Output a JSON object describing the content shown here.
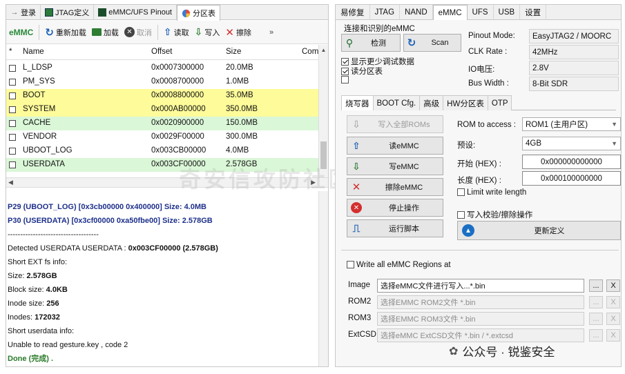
{
  "left": {
    "tabs": [
      {
        "icon": "login-icon",
        "label": "登录"
      },
      {
        "icon": "jtag-icon",
        "label": "JTAG定义"
      },
      {
        "icon": "emmc-chip-icon",
        "label": "eMMC/UFS Pinout"
      },
      {
        "icon": "pie-icon",
        "label": "分区表"
      }
    ],
    "toolbar": {
      "logo": "eMMC",
      "reload": "重新加载",
      "load": "加载",
      "cancel": "取消",
      "read": "读取",
      "write": "写入",
      "erase": "擦除",
      "overflow": "»"
    },
    "table": {
      "headers": [
        "*",
        "Name",
        "Offset",
        "Size",
        "Com"
      ],
      "rows": [
        {
          "name": "L_LDSP",
          "offset": "0x0007300000",
          "size": "20.0MB",
          "hl": ""
        },
        {
          "name": "PM_SYS",
          "offset": "0x0008700000",
          "size": "1.0MB",
          "hl": ""
        },
        {
          "name": "BOOT",
          "offset": "0x0008800000",
          "size": "35.0MB",
          "hl": "y"
        },
        {
          "name": "SYSTEM",
          "offset": "0x000AB00000",
          "size": "350.0MB",
          "hl": "y"
        },
        {
          "name": "CACHE",
          "offset": "0x0020900000",
          "size": "150.0MB",
          "hl": "g"
        },
        {
          "name": "VENDOR",
          "offset": "0x0029F00000",
          "size": "300.0MB",
          "hl": ""
        },
        {
          "name": "UBOOT_LOG",
          "offset": "0x003CB00000",
          "size": "4.0MB",
          "hl": ""
        },
        {
          "name": "USERDATA",
          "offset": "0x003CF00000",
          "size": "2.578GB",
          "hl": "g"
        }
      ]
    },
    "log": [
      {
        "pre": "",
        "b": "P29 (UBOOT_LOG) [0x3cb00000 0x400000] Size: 4.0MB",
        "blue": true
      },
      {
        "pre": "",
        "b": "P30 (USERDATA) [0x3cf00000 0xa50fbe00] Size: 2.578GB",
        "blue": true
      },
      {
        "pre": "------------------------------------",
        "b": "",
        "blue": false
      },
      {
        "pre": "Detected USERDATA USERDATA : ",
        "b": "0x003CF00000 (2.578GB)",
        "blue": false
      },
      {
        "pre": "Short EXT fs info:",
        "b": "",
        "blue": false
      },
      {
        "pre": "Size: ",
        "b": "2.578GB",
        "blue": false
      },
      {
        "pre": "Block size: ",
        "b": "4.0KB",
        "blue": false
      },
      {
        "pre": "Inode size: ",
        "b": "256",
        "blue": false
      },
      {
        "pre": "Inodes: ",
        "b": "172032",
        "blue": false
      },
      {
        "pre": "Short userdata info:",
        "b": "",
        "blue": false
      },
      {
        "pre": "Unable to read gesture.key , code 2",
        "b": "",
        "blue": false
      },
      {
        "pre": "",
        "b": "Done (完成) .",
        "green": true
      }
    ],
    "watermark": "奇安信攻防社区"
  },
  "right": {
    "tabs": [
      "易修复",
      "JTAG",
      "NAND",
      "eMMC",
      "UFS",
      "USB",
      "设置"
    ],
    "active_tab": 3,
    "group_title": "连接和识别的eMMC",
    "detect": "检测",
    "scan": "Scan",
    "chk_less_debug": "显示更少调试数据",
    "chk_read_partition": "读分区表",
    "info": [
      {
        "label": "Pinout Mode:",
        "value": "EasyJTAG2 / MOORC"
      },
      {
        "label": "CLK Rate :",
        "value": "42MHz"
      },
      {
        "label": "IO电压:",
        "value": "2.8V"
      },
      {
        "label": "Bus Width :",
        "value": "8-Bit SDR"
      }
    ],
    "subtabs": [
      "烧写器",
      "BOOT Cfg.",
      "高级",
      "HW分区表",
      "OTP"
    ],
    "buttons": {
      "write_all": "写入全部ROMs",
      "read": "读eMMC",
      "write": "写eMMC",
      "erase": "擦除eMMC",
      "stop": "停止操作",
      "script": "运行脚本",
      "update": "更新定义"
    },
    "rom_label": "ROM to access :",
    "rom_value": "ROM1 (主用户区)",
    "preset_label": "预设:",
    "preset_value": "4GB",
    "start_label": "开始 (HEX) :",
    "start_value": "0x000000000000",
    "length_label": "长度 (HEX) :",
    "length_value": "0x000100000000",
    "limit_write": "Limit write length",
    "write_verify": "写入校验/擦除操作",
    "write_all_regions": "Write all eMMC Regions at",
    "files": [
      {
        "label": "Image",
        "value": "选择eMMC文件进行写入...*.bin",
        "enabled": true
      },
      {
        "label": "ROM2",
        "value": "选择EMMC ROM2文件 *.bin",
        "enabled": false
      },
      {
        "label": "ROM3",
        "value": "选择EMMC ROM3文件 *.bin",
        "enabled": false
      },
      {
        "label": "ExtCSD",
        "value": "选择eMMC ExtCSD文件 *.bin / *.extcsd",
        "enabled": false
      }
    ],
    "browse": "...",
    "clear": "X"
  },
  "footer_watermark": "公众号 · 锐鉴安全"
}
